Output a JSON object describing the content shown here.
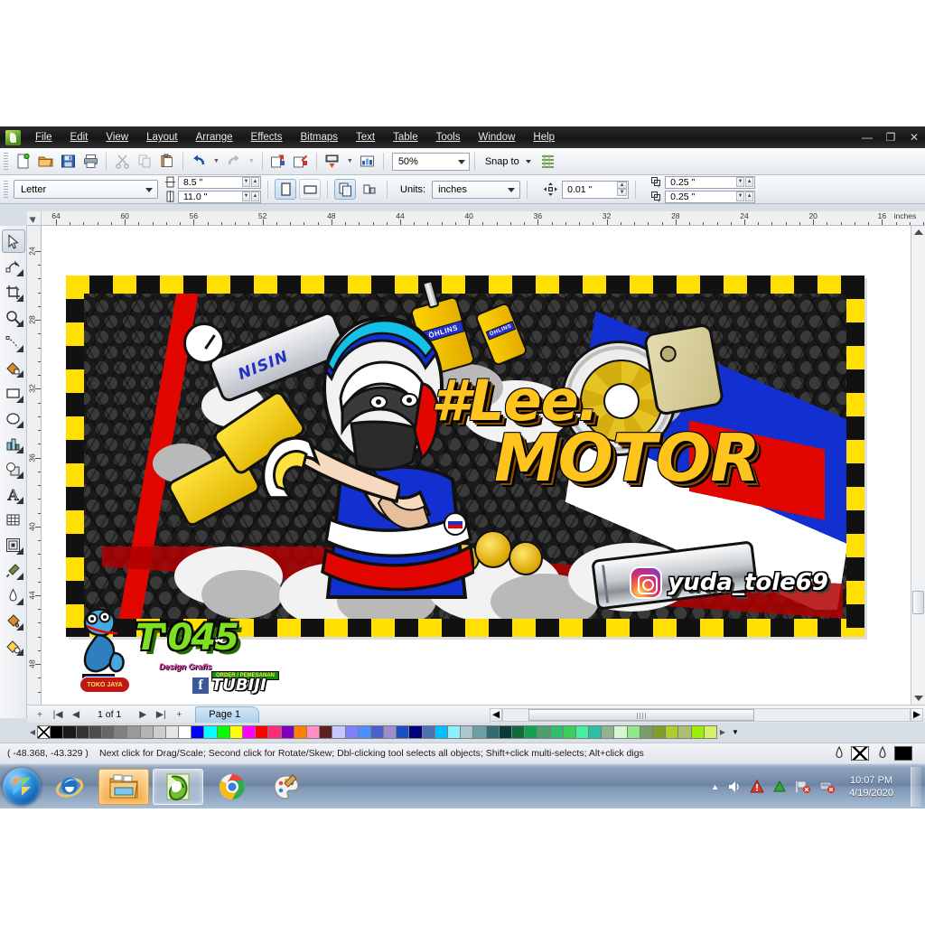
{
  "window": {
    "app_icon": "coreldraw-logo-icon",
    "minimize": "—",
    "maximize": "❐",
    "close": "✕"
  },
  "menubar": {
    "items": [
      {
        "label": "File"
      },
      {
        "label": "Edit"
      },
      {
        "label": "View"
      },
      {
        "label": "Layout"
      },
      {
        "label": "Arrange"
      },
      {
        "label": "Effects"
      },
      {
        "label": "Bitmaps"
      },
      {
        "label": "Text"
      },
      {
        "label": "Table"
      },
      {
        "label": "Tools"
      },
      {
        "label": "Window"
      },
      {
        "label": "Help"
      }
    ]
  },
  "toolbar": {
    "buttons": [
      {
        "name": "new-document-icon"
      },
      {
        "name": "open-document-icon"
      },
      {
        "name": "save-document-icon"
      },
      {
        "name": "print-document-icon"
      },
      {
        "name": "cut-icon"
      },
      {
        "name": "copy-icon"
      },
      {
        "name": "paste-icon"
      },
      {
        "name": "undo-icon"
      },
      {
        "name": "redo-icon"
      },
      {
        "name": "import-icon"
      },
      {
        "name": "export-icon"
      },
      {
        "name": "publish-pdf-icon"
      },
      {
        "name": "application-launcher-icon"
      }
    ],
    "zoom_level": "50%",
    "snap_to_label": "Snap to",
    "options_icon": "options-icon"
  },
  "propertybar": {
    "paper_type": "Letter",
    "page_width": "8.5 \"",
    "page_height": "11.0 \"",
    "orientation_portrait_icon": "portrait-orientation-icon",
    "orientation_landscape_icon": "landscape-orientation-icon",
    "all_pages_icon": "all-pages-icon",
    "current_page_icon": "current-page-only-icon",
    "units_label": "Units:",
    "units_value": "inches",
    "nudge_icon": "nudge-offset-icon",
    "nudge_value": "0.01 \"",
    "duplicate_x_icon": "duplicate-distance-x-icon",
    "duplicate_x_value": "0.25 \"",
    "duplicate_y_icon": "duplicate-distance-y-icon",
    "duplicate_y_value": "0.25 \""
  },
  "rulers": {
    "unit_label": "inches",
    "h_labels": [
      "64",
      "60",
      "56",
      "52",
      "48",
      "44",
      "40",
      "36",
      "32",
      "28",
      "24",
      "20",
      "16"
    ],
    "v_labels": [
      "24",
      "28",
      "32",
      "36",
      "40",
      "44",
      "48"
    ]
  },
  "toolbox": {
    "tools": [
      {
        "name": "pick-tool-icon",
        "label": "Pick"
      },
      {
        "name": "shape-tool-icon",
        "label": "Shape"
      },
      {
        "name": "crop-tool-icon",
        "label": "Crop"
      },
      {
        "name": "zoom-tool-icon",
        "label": "Zoom"
      },
      {
        "name": "freehand-tool-icon",
        "label": "Freehand"
      },
      {
        "name": "smart-fill-tool-icon",
        "label": "Smart Fill"
      },
      {
        "name": "rectangle-tool-icon",
        "label": "Rectangle"
      },
      {
        "name": "ellipse-tool-icon",
        "label": "Ellipse"
      },
      {
        "name": "polygon-tool-icon",
        "label": "Polygon"
      },
      {
        "name": "basic-shapes-tool-icon",
        "label": "Basic Shapes"
      },
      {
        "name": "text-tool-icon",
        "label": "Text"
      },
      {
        "name": "table-tool-icon",
        "label": "Table"
      },
      {
        "name": "blend-tool-icon",
        "label": "Blend"
      },
      {
        "name": "eyedropper-tool-icon",
        "label": "Color Eyedropper"
      },
      {
        "name": "outline-tool-icon",
        "label": "Outline"
      },
      {
        "name": "fill-tool-icon",
        "label": "Fill"
      },
      {
        "name": "interactive-fill-tool-icon",
        "label": "Interactive Fill"
      }
    ]
  },
  "pagebar": {
    "add-page-start": "+",
    "first": "|◀",
    "prev": "◀",
    "counter": "1 of 1",
    "next": "▶",
    "last": "▶|",
    "add-page-end": "+",
    "page_tab": "Page 1"
  },
  "statusbar": {
    "coordinates": "( -48.368, -43.329 )",
    "hint": "Next click for Drag/Scale; Second click for Rotate/Skew; Dbl-clicking tool selects all objects; Shift+click multi-selects; Alt+click digs",
    "fill_icon": "fill-color-icon",
    "outline_icon": "outline-color-icon",
    "fill_swatch": "none",
    "outline_swatch": "#000000"
  },
  "palette": {
    "scroll_up_icon": "palette-scroll-left-icon",
    "scroll_down_icon": "palette-scroll-right-icon",
    "expand_icon": "palette-expand-icon",
    "colors": [
      "none",
      "#000000",
      "#1a1a1a",
      "#333333",
      "#4d4d4d",
      "#666666",
      "#808080",
      "#999999",
      "#b3b3b3",
      "#cccccc",
      "#e6e6e6",
      "#ffffff",
      "#0000ff",
      "#00ffff",
      "#00ff00",
      "#ffff00",
      "#ff00ff",
      "#ff0000",
      "#ff2d78",
      "#8000c0",
      "#ff7f00",
      "#ff8fc0",
      "#5c2222",
      "#c8c8ff",
      "#8080ff",
      "#4d8fff",
      "#4a5ecc",
      "#9b8fd0",
      "#1a4fc0",
      "#000080",
      "#4a72b0",
      "#00c0ff",
      "#8cf0ff",
      "#a8c8cc",
      "#6f9ea4",
      "#2f6b70",
      "#0b3b38",
      "#0f6b3a",
      "#13a34e",
      "#4d9e6a",
      "#2fbf6b",
      "#3ccf5e",
      "#44f0a0",
      "#2fbfa0",
      "#8fb48f",
      "#d8f5d0",
      "#90e88a",
      "#7a9e6a",
      "#7f9e2a",
      "#b0cc28",
      "#a8c070",
      "#9cf000",
      "#d6f06a"
    ]
  },
  "taskbar": {
    "start_icon": "windows-start-orb-icon",
    "items": [
      {
        "name": "internet-explorer-icon",
        "state": "pinned"
      },
      {
        "name": "file-explorer-icon",
        "state": "active"
      },
      {
        "name": "coreldraw-icon",
        "state": "running"
      },
      {
        "name": "google-chrome-icon",
        "state": "pinned"
      },
      {
        "name": "paint-icon",
        "state": "pinned"
      }
    ],
    "tray": [
      {
        "name": "show-hidden-icons-icon"
      },
      {
        "name": "volume-icon"
      },
      {
        "name": "action-center-warning-icon"
      },
      {
        "name": "updater-icon"
      },
      {
        "name": "network-disconnected-icon"
      },
      {
        "name": "removable-media-icon"
      }
    ],
    "clock_time": "10:07 PM",
    "clock_date": "4/19/2020",
    "show_desktop": "show-desktop-button"
  },
  "artwork": {
    "title_line1": "#Lee.",
    "title_line2": "MOTOR",
    "instagram_handle": "yuda_tole69",
    "instagram_icon": "instagram-icon",
    "studio_name": "T'045",
    "studio_tagline": "Design Grafis",
    "studio_badge": "ORDER / PEMESANAN",
    "facebook_icon": "facebook-icon",
    "facebook_name": "TUBIJI",
    "studio_round_label": "TOKO JAYA",
    "brand_nisin": "NISIN",
    "brand_ohlins_1": "ÖHLINS",
    "brand_ohlins_2": "ÖHLINS",
    "colors": {
      "checker_yellow": "#ffe000",
      "checker_black": "#111111",
      "title_gold": "#ffc31e",
      "ribbon_red": "#e10600",
      "ribbon_blue": "#1230d0",
      "studio_green": "#7ee020"
    }
  }
}
